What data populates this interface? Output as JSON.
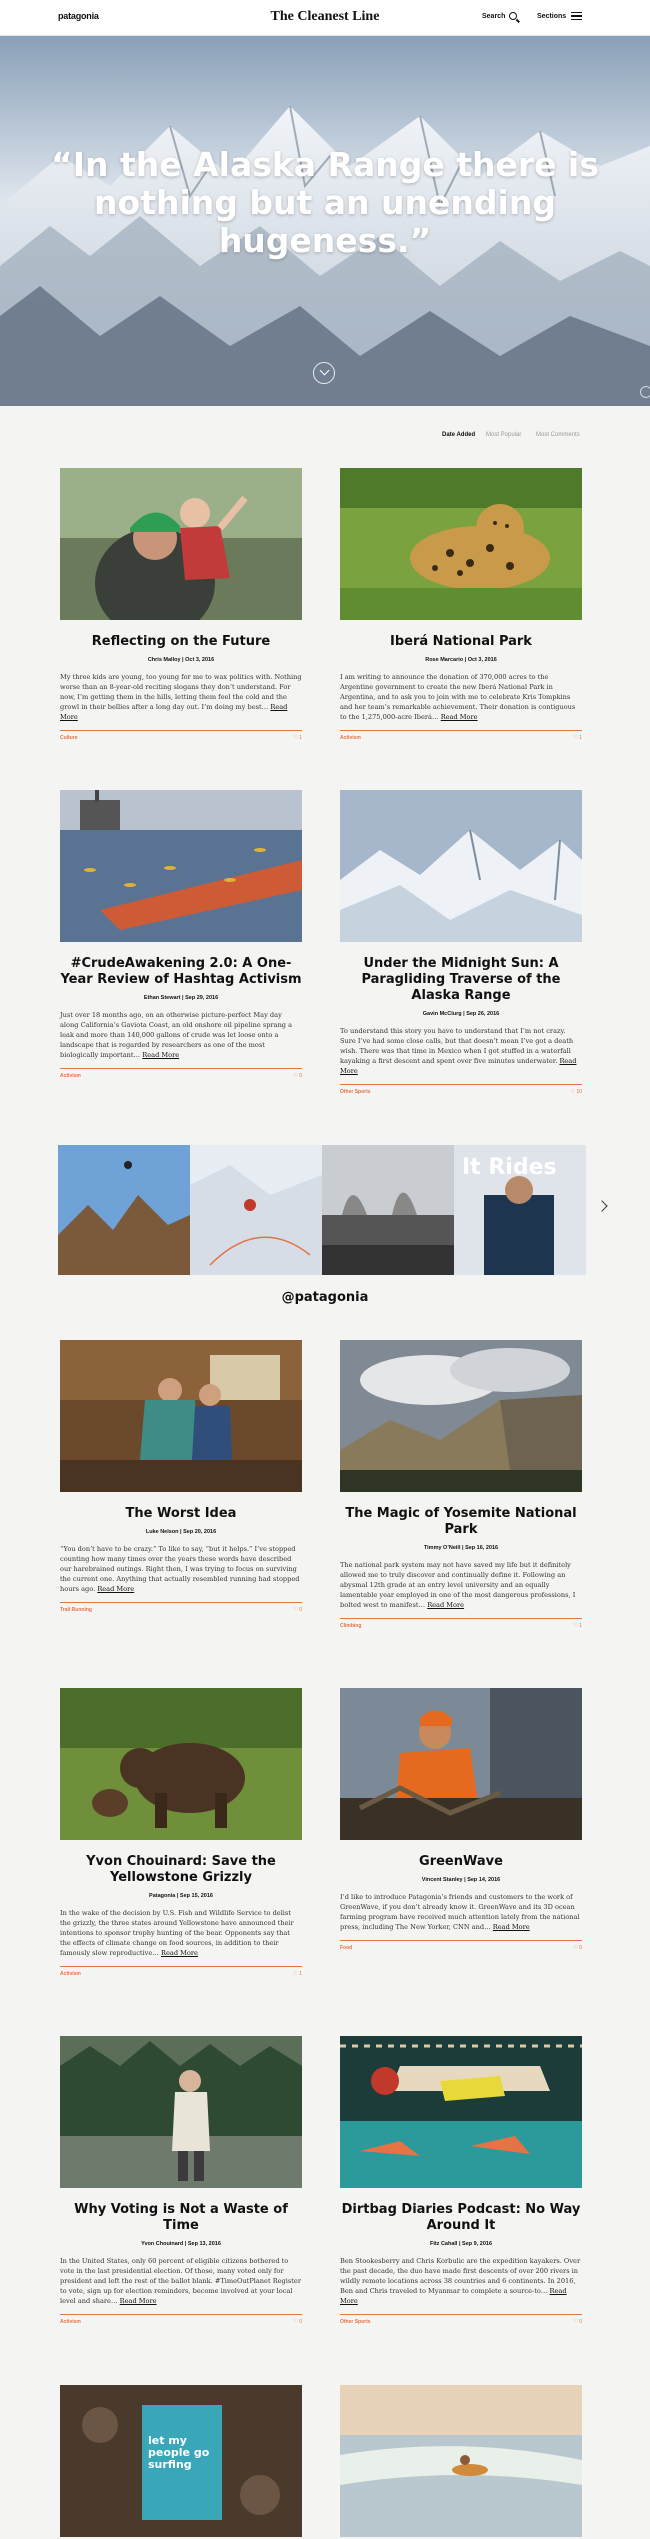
{
  "header": {
    "logo": "patagonia",
    "title": "The Cleanest Line",
    "search_label": "Search",
    "sections_label": "Sections"
  },
  "hero": {
    "quote": "“In the Alaska Range there is nothing but an unending hugeness.”"
  },
  "sort": {
    "options": [
      "Date Added",
      "Most Popular",
      "Most Comments"
    ]
  },
  "posts": [
    {
      "title": "Reflecting on the Future",
      "meta": "Chris Malloy  |  Oct 3, 2016",
      "excerpt": "My three kids are young, too young for me to wax politics with. Nothing worse than an 8-year-old reciting slogans they don’t understand. For now, I’m getting them in the hills, letting them feel the cold and the growl in their bellies after a long day out. I’m doing my best…",
      "more": "Read More",
      "category": "Culture",
      "count": "1"
    },
    {
      "title": "Iberá National Park",
      "meta": "Rose Marcario  |  Oct 3, 2016",
      "excerpt": "I am writing to announce the donation of 370,000 acres to the Argentine government to create the new Iberá National Park in Argentina, and to ask you to join with me to celebrate Kris Tompkins and her team’s remarkable achievement. Their donation is contiguous to the 1,275,000-acre Iberá…",
      "more": "Read More",
      "category": "Activism",
      "count": "1"
    },
    {
      "title": "#CrudeAwakening 2.0: A One-Year Review of Hashtag Activism",
      "meta": "Ethan Stewart  |  Sep 29, 2016",
      "excerpt": "Just over 18 months ago, on an otherwise picture-perfect May day along California’s Gaviota Coast, an old onshore oil pipeline sprang a leak and more than 140,000 gallons of crude was let loose onto a landscape that is regarded by researchers as one of the most biologically important…",
      "more": "Read More",
      "category": "Activism",
      "count": "0"
    },
    {
      "title": "Under the Midnight Sun: A Paragliding Traverse of the Alaska Range",
      "meta": "Gavin McClurg  |  Sep 26, 2016",
      "excerpt": "To understand this story you have to understand that I’m not crazy. Sure I’ve had some close calls, but that doesn’t mean I’ve got a death wish. There was that time in Mexico when I got stuffed in a waterfall kayaking a first descent and spent over five minutes underwater.",
      "more": "Read More",
      "category": "Other Sports",
      "count": "10"
    },
    {
      "title": "The Worst Idea",
      "meta": "Luke Nelson  |  Sep 20, 2016",
      "excerpt": "“You don’t have to be crazy.” To like to say, “but it helps.” I’ve stopped counting how many times over the years these words have described our harebrained outings. Right then, I was trying to focus on surviving the current one. Anything that actually resembled running had stopped hours ago.",
      "more": "Read More",
      "category": "Trail Running",
      "count": "0"
    },
    {
      "title": "The Magic of Yosemite National Park",
      "meta": "Timmy O’Neill  |  Sep 16, 2016",
      "excerpt": "The national park system may not have saved my life but it definitely allowed me to truly discover and continually define it. Following an abysmal 12th grade at an entry level university and an equally lamentable year employed in one of the most dangerous professions, I bolted west to manifest…",
      "more": "Read More",
      "category": "Climbing",
      "count": "1"
    },
    {
      "title": "Yvon Chouinard: Save the Yellowstone Grizzly",
      "meta": "Patagonia  |  Sep 15, 2016",
      "excerpt": "In the wake of the decision by U.S. Fish and Wildlife Service to delist the grizzly, the three states around Yellowstone have announced their intentions to sponsor trophy hunting of the bear. Opponents say that the effects of climate change on food sources, in addition to their famously slow reproductive…",
      "more": "Read More",
      "category": "Activism",
      "count": "1"
    },
    {
      "title": "GreenWave",
      "meta": "Vincent Stanley  |  Sep 14, 2016",
      "excerpt": "I’d like to introduce Patagonia’s friends and customers to the work of GreenWave, if you don’t already know it. GreenWave and its 3D ocean farming program have received much attention lately from the national press, including The New Yorker, CNN and…",
      "more": "Read More",
      "category": "Food",
      "count": "0"
    },
    {
      "title": "Why Voting is Not a Waste of Time",
      "meta": "Yvon Chouinard  |  Sep 13, 2016",
      "excerpt": "In the United States, only 60 percent of eligible citizens bothered to vote in the last presidential election. Of those, many voted only for president and left the rest of the ballot blank. #TimeOutPlanet Register to vote, sign up for election reminders, become involved at your local level and share…",
      "more": "Read More",
      "category": "Activism",
      "count": "0"
    },
    {
      "title": "Dirtbag Diaries Podcast: No Way Around It",
      "meta": "Fitz Cahall  |  Sep 9, 2016",
      "excerpt": "Ben Stookesberry and Chris Korbulic are the expedition kayakers. Over the past decade, the duo have made first descents of over 200 rivers in wildly remote locations across 38 countries and 6 continents. In 2016, Ben and Chris traveled to Myanmar to complete a source-to…",
      "more": "Read More",
      "category": "Other Sports",
      "count": "0"
    },
    {
      "title": "",
      "meta": "",
      "excerpt": "",
      "more": "",
      "category": "",
      "count": ""
    },
    {
      "title": "",
      "meta": "",
      "excerpt": "",
      "more": "",
      "category": "",
      "count": ""
    }
  ],
  "instagram": {
    "handle": "@patagonia",
    "tile_overlay": "It Rides"
  },
  "bottom_book": {
    "title": "let my people go surfing"
  },
  "colors": {
    "accent": "#e57345",
    "background": "#f4f4f2"
  },
  "icons": [
    "search-icon",
    "menu-icon",
    "scroll-down-icon",
    "next-arrow-icon"
  ]
}
